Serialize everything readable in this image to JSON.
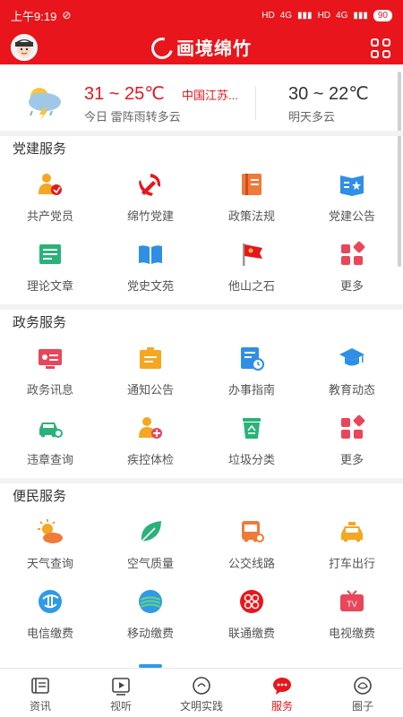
{
  "status_bar": {
    "time": "上午9:19",
    "battery": "90",
    "network1": "4G",
    "network2": "4G",
    "hd1": "HD",
    "hd2": "HD"
  },
  "header": {
    "title": "画境绵竹"
  },
  "weather": {
    "today_temp": "31 ~ 25℃",
    "location": "中国江苏...",
    "today_desc": "今日 雷阵雨转多云",
    "tomorrow_temp": "30 ~ 22℃",
    "tomorrow_desc": "明天多云"
  },
  "sections": [
    {
      "title": "党建服务",
      "items": [
        {
          "label": "共产党员",
          "icon": "party-member-icon"
        },
        {
          "label": "绵竹党建",
          "icon": "party-emblem-icon"
        },
        {
          "label": "政策法规",
          "icon": "law-book-icon"
        },
        {
          "label": "党建公告",
          "icon": "party-notice-icon"
        },
        {
          "label": "理论文章",
          "icon": "theory-article-icon"
        },
        {
          "label": "党史文苑",
          "icon": "open-book-icon"
        },
        {
          "label": "他山之石",
          "icon": "party-flag-icon"
        },
        {
          "label": "更多",
          "icon": "more-grid-icon"
        }
      ]
    },
    {
      "title": "政务服务",
      "items": [
        {
          "label": "政务讯息",
          "icon": "gov-news-icon"
        },
        {
          "label": "通知公告",
          "icon": "notice-board-icon"
        },
        {
          "label": "办事指南",
          "icon": "guide-clock-icon"
        },
        {
          "label": "教育动态",
          "icon": "graduation-cap-icon"
        },
        {
          "label": "违章查询",
          "icon": "car-search-icon"
        },
        {
          "label": "疾控体检",
          "icon": "medical-check-icon"
        },
        {
          "label": "垃圾分类",
          "icon": "recycle-bin-icon"
        },
        {
          "label": "更多",
          "icon": "more-grid-icon"
        }
      ]
    },
    {
      "title": "便民服务",
      "items": [
        {
          "label": "天气查询",
          "icon": "sun-cloud-icon"
        },
        {
          "label": "空气质量",
          "icon": "leaf-icon"
        },
        {
          "label": "公交线路",
          "icon": "bus-icon"
        },
        {
          "label": "打车出行",
          "icon": "taxi-icon"
        },
        {
          "label": "电信缴费",
          "icon": "telecom-logo-icon"
        },
        {
          "label": "移动缴费",
          "icon": "mobile-logo-icon"
        },
        {
          "label": "联通缴费",
          "icon": "unicom-logo-icon"
        },
        {
          "label": "电视缴费",
          "icon": "tv-icon"
        }
      ]
    }
  ],
  "tabbar": [
    {
      "label": "资讯",
      "icon": "news-icon",
      "active": false
    },
    {
      "label": "视听",
      "icon": "video-play-icon",
      "active": false
    },
    {
      "label": "文明实践",
      "icon": "practice-icon",
      "active": false
    },
    {
      "label": "服务",
      "icon": "service-chat-icon",
      "active": true
    },
    {
      "label": "圈子",
      "icon": "circle-icon",
      "active": false
    }
  ],
  "colors": {
    "brand": "#e8161c",
    "orange": "#f5a623",
    "blue": "#2f8fe6",
    "green": "#2ab27b",
    "red": "#e8465a"
  }
}
